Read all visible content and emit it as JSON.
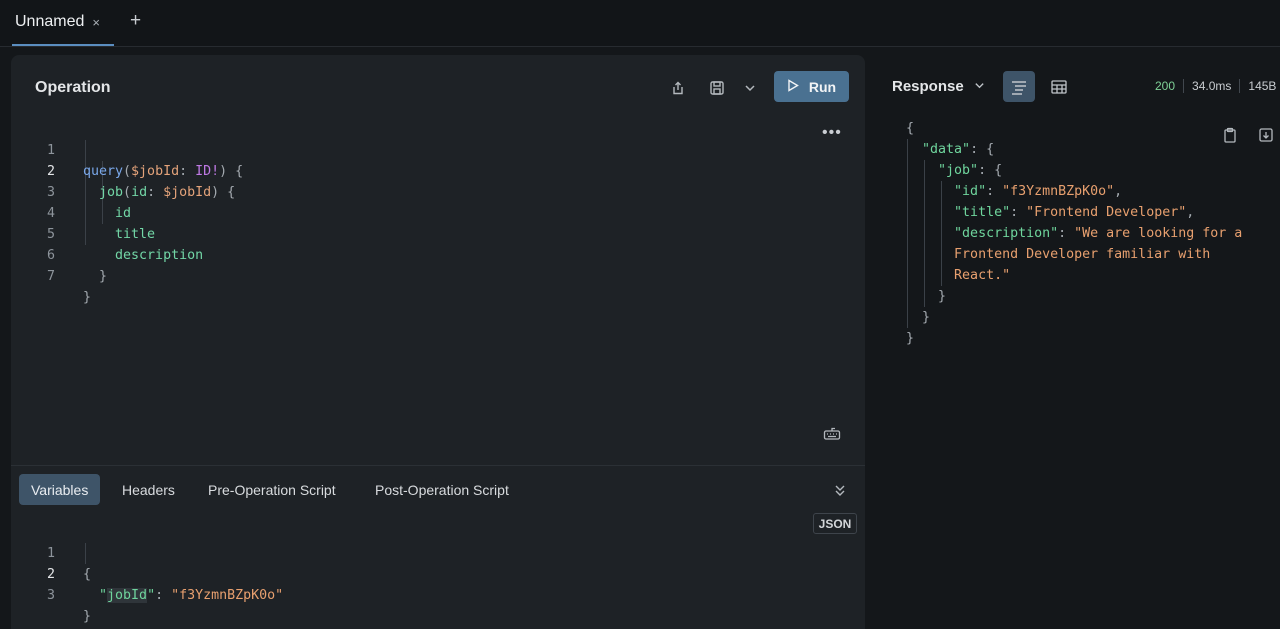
{
  "tabs": [
    {
      "label": "Unnamed",
      "close": "×"
    }
  ],
  "tab_add": "+",
  "operation": {
    "title": "Operation",
    "run_label": "Run",
    "more": "•••",
    "lines": [
      {
        "num": "1"
      },
      {
        "num": "2"
      },
      {
        "num": "3",
        "text": "id"
      },
      {
        "num": "4",
        "text": "title"
      },
      {
        "num": "5",
        "text": "description"
      },
      {
        "num": "6",
        "text": "}"
      },
      {
        "num": "7",
        "text": "}"
      }
    ],
    "query_kw": "query",
    "job_var": "$jobId",
    "id_type": "ID",
    "job_field": "job",
    "id_arg": "id"
  },
  "variables": {
    "tabs": [
      "Variables",
      "Headers",
      "Pre-Operation Script",
      "Post-Operation Script"
    ],
    "json_badge": "JSON",
    "lines": [
      {
        "num": "1",
        "text": "{"
      },
      {
        "num": "2"
      },
      {
        "num": "3",
        "text": "}"
      }
    ],
    "key": "jobId",
    "value": "\"f3YzmnBZpK0o\""
  },
  "response": {
    "title": "Response",
    "status": "200",
    "time": "34.0ms",
    "size": "145B",
    "json": {
      "data_key": "\"data\"",
      "job_key": "\"job\"",
      "id_key": "\"id\"",
      "id_val": "\"f3YzmnBZpK0o\"",
      "title_key": "\"title\"",
      "title_val": "\"Frontend Developer\"",
      "desc_key": "\"description\"",
      "desc_val_1": "\"We are looking for a",
      "desc_val_2": "Frontend Developer familiar with",
      "desc_val_3": "React.\""
    }
  },
  "colors": {
    "accent": "#4a7191",
    "tab_underline": "#5b8ec0",
    "status_ok": "#7fd197",
    "string": "#e8a06f",
    "key": "#6fd59d"
  },
  "icons": [
    "share-icon",
    "save-icon",
    "chevron-down-icon",
    "play-icon",
    "more-icon",
    "keyboard-icon",
    "collapse-icon",
    "format-icon",
    "table-icon",
    "copy-icon",
    "download-icon"
  ]
}
